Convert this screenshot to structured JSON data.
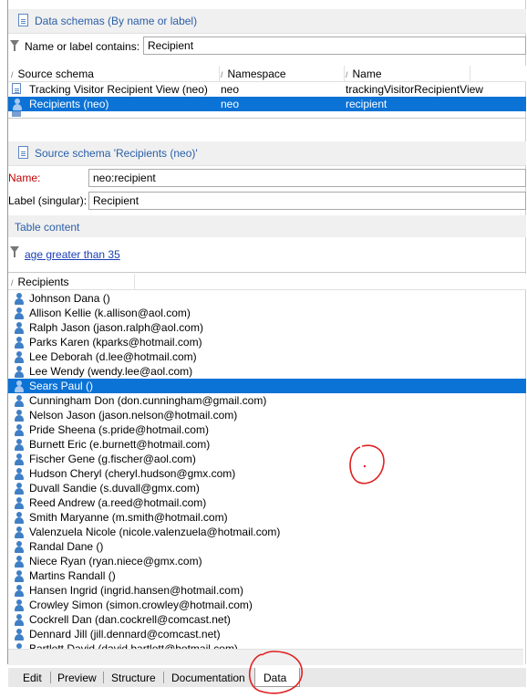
{
  "schemas_panel": {
    "title": "Data schemas (By name or label)",
    "filter_label": "Name or label contains:",
    "filter_value": "Recipient",
    "columns": [
      "Source schema",
      "Namespace",
      "Name"
    ],
    "rows": [
      {
        "source": "Tracking Visitor Recipient View (neo)",
        "namespace": "neo",
        "name": "trackingVisitorRecipientView",
        "icon": "document-icon"
      },
      {
        "source": "Recipients (neo)",
        "namespace": "neo",
        "name": "recipient",
        "icon": "person-icon",
        "selected": true
      }
    ]
  },
  "source_panel": {
    "title": "Source schema 'Recipients (neo)'",
    "name_label": "Name:",
    "name_value": "neo:recipient",
    "label_label": "Label (singular):",
    "label_value": "Recipient"
  },
  "table_content": {
    "title": "Table content",
    "filter_link": "age greater than 35",
    "column": "Recipients",
    "records": [
      "Johnson Dana ()",
      "Allison Kellie (k.allison@aol.com)",
      "Ralph Jason (jason.ralph@aol.com)",
      "Parks Karen (kparks@hotmail.com)",
      "Lee Deborah (d.lee@hotmail.com)",
      "Lee Wendy (wendy.lee@aol.com)",
      "Sears Paul ()",
      "Cunningham Don (don.cunningham@gmail.com)",
      "Nelson Jason (jason.nelson@hotmail.com)",
      "Pride Sheena (s.pride@hotmail.com)",
      "Burnett Eric (e.burnett@hotmail.com)",
      "Fischer Gene (g.fischer@aol.com)",
      "Hudson Cheryl (cheryl.hudson@gmx.com)",
      "Duvall Sandie (s.duvall@gmx.com)",
      "Reed Andrew (a.reed@hotmail.com)",
      "Smith Maryanne (m.smith@hotmail.com)",
      "Valenzuela Nicole (nicole.valenzuela@hotmail.com)",
      "Randal Dane ()",
      "Niece Ryan (ryan.niece@gmx.com)",
      "Martins Randall ()",
      "Hansen Ingrid (ingrid.hansen@hotmail.com)",
      "Crowley Simon (simon.crowley@hotmail.com)",
      "Cockrell Dan (dan.cockrell@comcast.net)",
      "Dennard Jill (jill.dennard@comcast.net)",
      "Bartlett David (david.bartlett@hotmail.com)"
    ],
    "selected_index": 6
  },
  "tabs": [
    "Edit",
    "Preview",
    "Structure",
    "Documentation",
    "Data"
  ],
  "active_tab": "Data",
  "colors": {
    "accent": "#0b72d6",
    "section_title": "#2a5fa8",
    "annotation": "#e02020"
  }
}
